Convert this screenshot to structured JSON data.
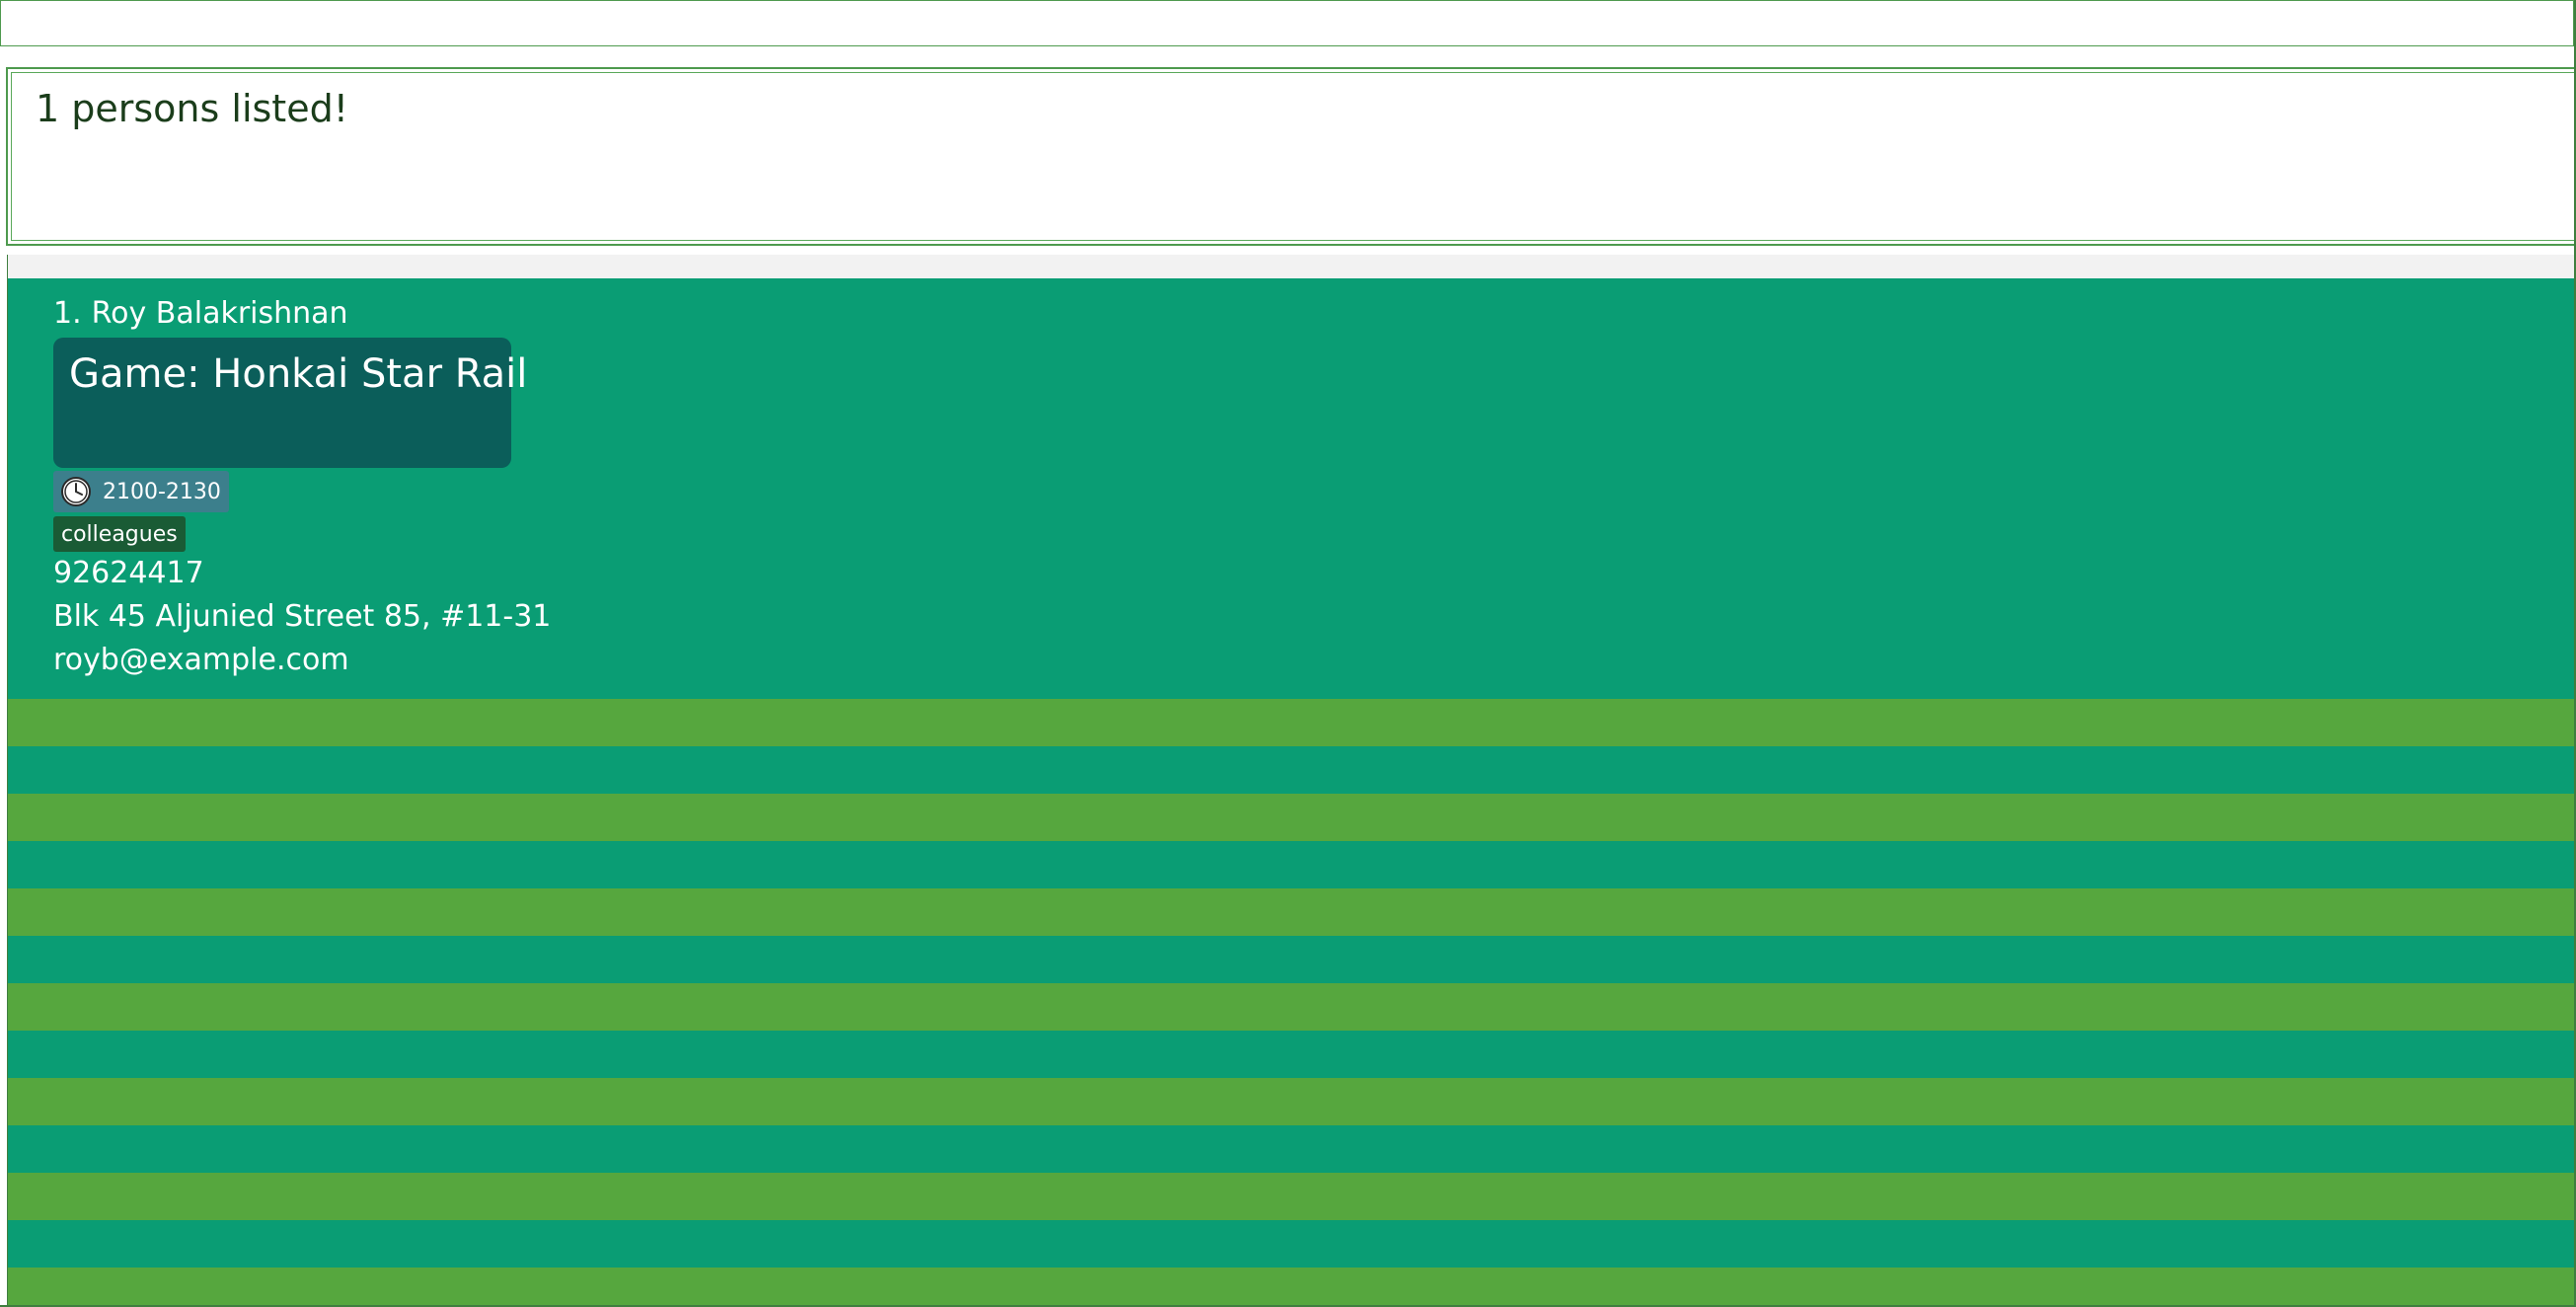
{
  "command_box": {
    "value": "",
    "placeholder": ""
  },
  "result_display": {
    "message": "1 persons listed!"
  },
  "person_list": {
    "persons": [
      {
        "index": "1.",
        "name": "Roy Balakrishnan",
        "game": "Game: Honkai Star Rail",
        "time": "2100-2130",
        "tags": [
          "colleagues"
        ],
        "phone": "92624417",
        "address": "Blk 45 Aljunied Street 85, #11-31",
        "email": "royb@example.com"
      }
    ],
    "empty_row_count": 13
  },
  "icons": {
    "time": "clock-icon"
  },
  "colors": {
    "card_background": "#0a9d74",
    "game_box": "#0b5e5a",
    "time_badge": "#3c7f8c",
    "tag_badge": "#1a5b35",
    "stripe_green": "#56a73e",
    "stripe_teal": "#0a9d74",
    "border": "#4e9a4e",
    "result_text": "#1b3d1b"
  }
}
